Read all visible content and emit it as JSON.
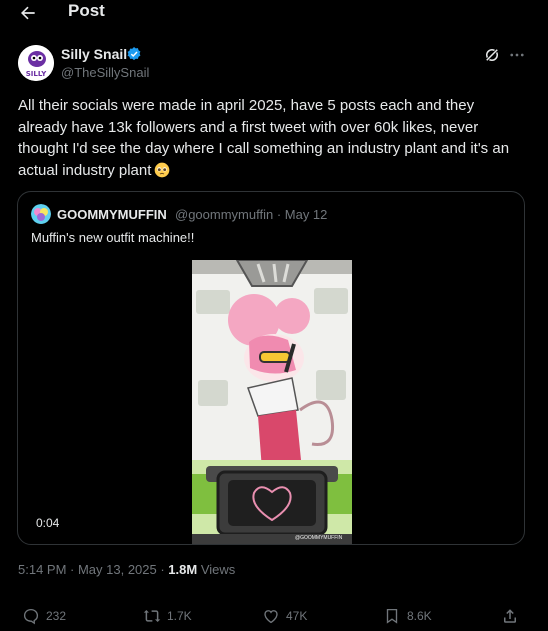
{
  "header": {
    "title": "Post"
  },
  "post": {
    "author_name": "Silly Snail",
    "author_handle": "@TheSillySnail",
    "avatar_text": "SILLY",
    "text": "All their socials were made in april 2025, have 5 posts each and they already have 13k followers and a first tweet with over 60k likes, never thought I'd see the day where I call something an industry plant and it's an actual industry plant",
    "emoji": "pleading-face",
    "timestamp": "5:14 PM · May 13, 2025 · ",
    "views_count": "1.8M",
    "views_label": " Views"
  },
  "quote": {
    "author_name": "GOOMMYMUFFIN",
    "author_handle": "@goommymuffin · May 12",
    "text": "Muffin's new outfit machine!!",
    "video_duration": "0:04",
    "video_watermark": "@GOOMMYMUFFIN"
  },
  "actions": {
    "replies": "232",
    "reposts": "1.7K",
    "likes": "47K",
    "bookmarks": "8.6K"
  },
  "colors": {
    "accent": "#1d9bf0",
    "muted": "#71767b",
    "border": "#2f3336"
  }
}
